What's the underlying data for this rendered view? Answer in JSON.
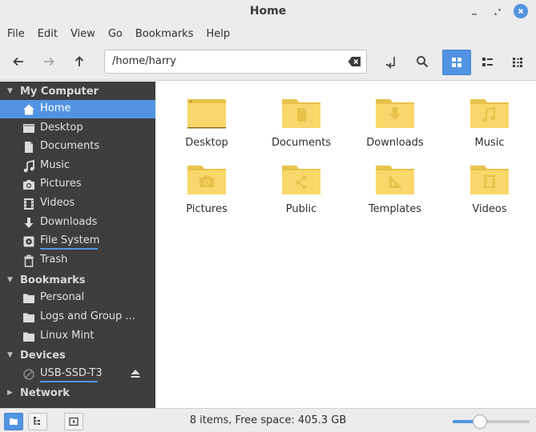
{
  "window": {
    "title": "Home"
  },
  "menu": [
    "File",
    "Edit",
    "View",
    "Go",
    "Bookmarks",
    "Help"
  ],
  "location": {
    "path": "/home/harry"
  },
  "sidebar": {
    "sections": [
      {
        "title": "My Computer",
        "expanded": true
      },
      {
        "title": "Bookmarks",
        "expanded": true
      },
      {
        "title": "Devices",
        "expanded": true
      },
      {
        "title": "Network",
        "expanded": false
      }
    ],
    "computer": [
      {
        "label": "Home",
        "icon": "home-icon",
        "selected": true
      },
      {
        "label": "Desktop",
        "icon": "desktop-icon"
      },
      {
        "label": "Documents",
        "icon": "document-icon"
      },
      {
        "label": "Music",
        "icon": "music-icon"
      },
      {
        "label": "Pictures",
        "icon": "camera-icon"
      },
      {
        "label": "Videos",
        "icon": "film-icon"
      },
      {
        "label": "Downloads",
        "icon": "download-icon"
      },
      {
        "label": "File System",
        "icon": "drive-icon",
        "usage": 0.55
      },
      {
        "label": "Trash",
        "icon": "trash-icon"
      }
    ],
    "bookmarks": [
      {
        "label": "Personal",
        "icon": "folder-icon"
      },
      {
        "label": "Logs and Group ...",
        "icon": "folder-icon"
      },
      {
        "label": "Linux Mint",
        "icon": "folder-icon"
      }
    ],
    "devices": [
      {
        "label": "USB-SSD-T3",
        "icon": "usb-drive-icon",
        "usage": 0.55
      }
    ]
  },
  "files": [
    {
      "name": "Desktop",
      "emblem": "desktop-icon"
    },
    {
      "name": "Documents",
      "emblem": "document-icon"
    },
    {
      "name": "Downloads",
      "emblem": "download-icon"
    },
    {
      "name": "Music",
      "emblem": "music-icon"
    },
    {
      "name": "Pictures",
      "emblem": "camera-icon"
    },
    {
      "name": "Public",
      "emblem": "share-icon"
    },
    {
      "name": "Templates",
      "emblem": "template-icon"
    },
    {
      "name": "Videos",
      "emblem": "film-icon"
    }
  ],
  "status": {
    "text": "8 items, Free space: 405.3 GB",
    "zoom_level": 0.35
  },
  "colors": {
    "accent": "#5294e2",
    "sidebar_bg": "#3d3d3d",
    "folder": "#f9d76a",
    "folder_dark": "#e8c24a"
  }
}
